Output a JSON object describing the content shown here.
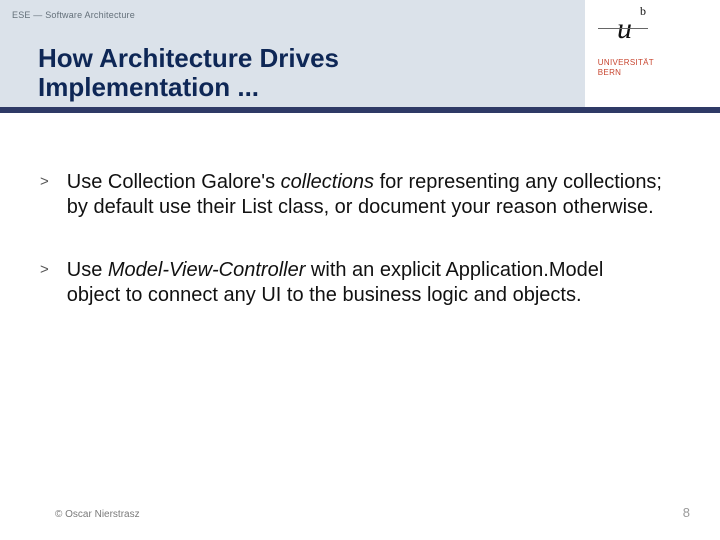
{
  "header": {
    "course_label": "ESE — Software Architecture",
    "title_line1": "How Architecture Drives",
    "title_line2": "Implementation ..."
  },
  "logo": {
    "u": "u",
    "b": "b",
    "uni_line1": "UNIVERSITÄT",
    "uni_line2": "BERN"
  },
  "bullets": [
    {
      "marker": ">",
      "pre": "Use Collection Galore's ",
      "em": "collections",
      "post": " for representing any collections; by default use their List class, or document your reason otherwise."
    },
    {
      "marker": ">",
      "pre": "Use ",
      "em": "Model-View-Controller",
      "post": " with an explicit Application.Model object to connect any UI to the business logic and objects."
    }
  ],
  "footer": {
    "copyright": "© Oscar Nierstrasz",
    "page_number": "8"
  }
}
